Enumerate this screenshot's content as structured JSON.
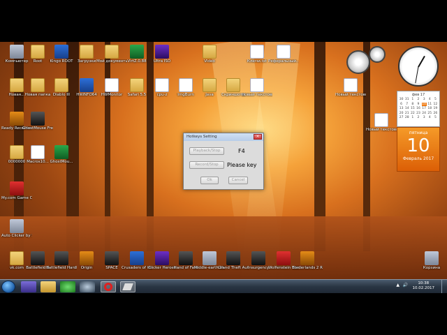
{
  "desktop_icons": [
    {
      "label": "Компьютер",
      "kind": "app7",
      "icon": "computer-icon"
    },
    {
      "label": "Root",
      "kind": "folder",
      "icon": "folder-icon"
    },
    {
      "label": "Kingo ROOT",
      "kind": "app1",
      "icon": "kingo-root-icon"
    },
    {
      "label": "Загрузки",
      "kind": "folder",
      "icon": "folder-icon"
    },
    {
      "label": "Мой документы список",
      "kind": "folder",
      "icon": "folder-icon"
    },
    {
      "label": "VirtZ.0.88",
      "kind": "app5",
      "icon": "app-icon"
    },
    {
      "label": "Ultra ISO",
      "kind": "app4",
      "icon": "app-icon"
    },
    {
      "label": "Video",
      "kind": "folder",
      "icon": "folder-icon"
    },
    {
      "label": "Ключи.txt",
      "kind": "doc",
      "icon": "text-file-icon"
    },
    {
      "label": "Реферальный...",
      "kind": "doc",
      "icon": "text-file-icon"
    },
    {
      "label": "Новая...",
      "kind": "folder",
      "icon": "folder-icon"
    },
    {
      "label": "Новая папка",
      "kind": "folder",
      "icon": "folder-icon"
    },
    {
      "label": "Diablo III",
      "kind": "folder",
      "icon": "folder-icon"
    },
    {
      "label": "HWiNFO64",
      "kind": "app1",
      "icon": "hwinfo-icon"
    },
    {
      "label": "HWMonitor",
      "kind": "doc",
      "icon": "app-icon"
    },
    {
      "label": "Safari 5.5",
      "kind": "folder",
      "icon": "folder-icon"
    },
    {
      "label": "cpu-z",
      "kind": "doc",
      "icon": "app-icon"
    },
    {
      "label": "ImgBurn",
      "kind": "doc",
      "icon": "app-icon"
    },
    {
      "label": "Java",
      "kind": "folder",
      "icon": "folder-icon"
    },
    {
      "label": "Скриншоты",
      "kind": "folder",
      "icon": "folder-icon"
    },
    {
      "label": "Новый текстовый",
      "kind": "doc",
      "icon": "text-file-icon"
    },
    {
      "label": "Новый текстовый",
      "kind": "doc",
      "icon": "text-file-icon"
    },
    {
      "label": "Новый текстовый",
      "kind": "doc",
      "icon": "text-file-icon"
    },
    {
      "label": "Ready Recorder Free",
      "kind": "app6",
      "icon": "app-icon"
    },
    {
      "label": "GhostMouse Free",
      "kind": "app3",
      "icon": "app-icon"
    },
    {
      "label": "0000000",
      "kind": "folder",
      "icon": "folder-icon"
    },
    {
      "label": "Macros10...",
      "kind": "doc",
      "icon": "app-icon"
    },
    {
      "label": "GhostMou...",
      "kind": "app5",
      "icon": "app-icon"
    },
    {
      "label": "My.com Game Center",
      "kind": "app2",
      "icon": "game-center-icon"
    },
    {
      "label": "Auto Clicker by Shocker",
      "kind": "app7",
      "icon": "mouse-icon"
    },
    {
      "label": "vk.com",
      "kind": "folder",
      "icon": "folder-icon"
    },
    {
      "label": "Battlefield 4",
      "kind": "app3",
      "icon": "game-icon"
    },
    {
      "label": "Battlefield Hardline",
      "kind": "app3",
      "icon": "game-icon"
    },
    {
      "label": "Origin",
      "kind": "app6",
      "icon": "origin-icon"
    },
    {
      "label": "SPACE",
      "kind": "app3",
      "icon": "game-icon"
    },
    {
      "label": "Crusaders of the Lost Idols",
      "kind": "app1",
      "icon": "game-icon"
    },
    {
      "label": "Clicker Heroes",
      "kind": "app4",
      "icon": "game-icon"
    },
    {
      "label": "Hand of Fate",
      "kind": "app3",
      "icon": "game-icon"
    },
    {
      "label": "Middle-earth Shadow of...",
      "kind": "app7",
      "icon": "game-icon"
    },
    {
      "label": "Grand Theft Auto V",
      "kind": "app3",
      "icon": "game-icon"
    },
    {
      "label": "Insurgency",
      "kind": "app3",
      "icon": "game-icon"
    },
    {
      "label": "Wolfenstein The New ...",
      "kind": "app2",
      "icon": "game-icon"
    },
    {
      "label": "Borderlands 2 RU",
      "kind": "app6",
      "icon": "game-icon"
    },
    {
      "label": "Корзина",
      "kind": "app7",
      "icon": "recycle-bin-icon"
    }
  ],
  "dialog": {
    "title": "Hotkeys Setting",
    "playback_label": "Playback/Stop",
    "playback_key": "F4",
    "record_label": "Record/Stop",
    "record_key": "Please key",
    "ok_label": "Ok",
    "cancel_label": "Cancel"
  },
  "calendar": {
    "month_label": "фев 17",
    "weekday": "пятница",
    "day": "10",
    "month_year": "Февраль 2017",
    "days": [
      "30",
      "31",
      "1",
      "2",
      "3",
      "4",
      "5",
      "6",
      "7",
      "8",
      "9",
      "10",
      "11",
      "12",
      "13",
      "14",
      "15",
      "16",
      "17",
      "18",
      "19",
      "20",
      "21",
      "22",
      "23",
      "24",
      "25",
      "26",
      "27",
      "28",
      "1",
      "2",
      "3",
      "4",
      "5"
    ],
    "today_index": 11
  },
  "taskbar": {
    "time": "10:38",
    "date": "10.02.2017",
    "tray_arrow": "▲",
    "volume_icon": "🔊"
  },
  "colors": {
    "accent": "#f07c14"
  }
}
